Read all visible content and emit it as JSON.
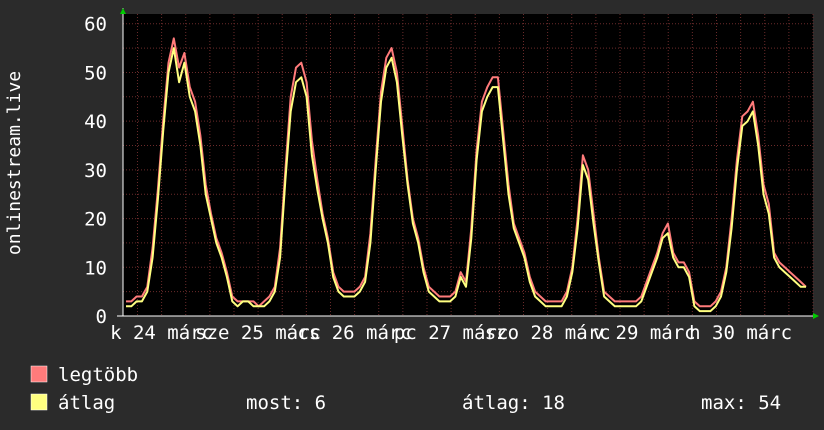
{
  "chart_data": {
    "type": "line",
    "ylabel": "onlinestream.live",
    "ylim": [
      0,
      62
    ],
    "yticks": [
      0,
      10,
      20,
      30,
      40,
      50,
      60
    ],
    "grid": true,
    "x_tick_labels": [
      "k 24 márc",
      "sze 25 márc",
      "cs 26 márc",
      "pc 27 márc",
      "szo 28 márc",
      "v 29 márc",
      "h 30 márc"
    ],
    "series": [
      {
        "name": "legtöbb",
        "color": "#ff7b7b",
        "values": [
          3,
          3,
          4,
          4,
          6,
          14,
          26,
          40,
          52,
          57,
          51,
          54,
          47,
          44,
          37,
          27,
          21,
          16,
          13,
          9,
          4,
          3,
          3,
          3,
          3,
          2,
          3,
          4,
          6,
          14,
          30,
          45,
          51,
          52,
          48,
          36,
          28,
          21,
          16,
          9,
          6,
          5,
          5,
          5,
          6,
          8,
          17,
          32,
          46,
          53,
          55,
          50,
          39,
          28,
          20,
          16,
          10,
          6,
          5,
          4,
          4,
          4,
          5,
          9,
          7,
          18,
          34,
          44,
          47,
          49,
          49,
          38,
          27,
          19,
          16,
          13,
          8,
          5,
          4,
          3,
          3,
          3,
          3,
          5,
          10,
          20,
          33,
          30,
          21,
          12,
          5,
          4,
          3,
          3,
          3,
          3,
          3,
          4,
          7,
          10,
          13,
          17,
          19,
          13,
          11,
          11,
          9,
          3,
          2,
          2,
          2,
          3,
          5,
          10,
          20,
          32,
          41,
          42,
          44,
          37,
          27,
          23,
          13,
          11,
          10,
          9,
          8,
          7,
          6
        ]
      },
      {
        "name": "átlag",
        "color": "#ffff80",
        "values": [
          2,
          2,
          3,
          3,
          5,
          12,
          24,
          38,
          50,
          55,
          48,
          52,
          45,
          42,
          35,
          25,
          20,
          15,
          12,
          8,
          3,
          2,
          3,
          3,
          2,
          2,
          2,
          3,
          5,
          12,
          28,
          42,
          48,
          49,
          45,
          33,
          26,
          20,
          15,
          8,
          5,
          4,
          4,
          4,
          5,
          7,
          15,
          30,
          44,
          51,
          53,
          48,
          37,
          27,
          19,
          15,
          9,
          5,
          4,
          3,
          3,
          3,
          4,
          8,
          6,
          16,
          32,
          42,
          45,
          47,
          47,
          36,
          25,
          18,
          15,
          12,
          7,
          4,
          3,
          2,
          2,
          2,
          2,
          4,
          9,
          18,
          31,
          28,
          19,
          11,
          4,
          3,
          2,
          2,
          2,
          2,
          2,
          3,
          6,
          9,
          12,
          16,
          17,
          12,
          10,
          10,
          8,
          2,
          1,
          1,
          1,
          2,
          4,
          9,
          18,
          30,
          39,
          40,
          42,
          35,
          25,
          21,
          12,
          10,
          9,
          8,
          7,
          6,
          6
        ]
      }
    ]
  },
  "legend": [
    {
      "label": "legtöbb",
      "color": "#ff7b7b"
    },
    {
      "label": "átlag",
      "color": "#ffff80"
    }
  ],
  "stats": {
    "now": "most: 6",
    "avg": "átlag: 18",
    "max": "max: 54"
  }
}
